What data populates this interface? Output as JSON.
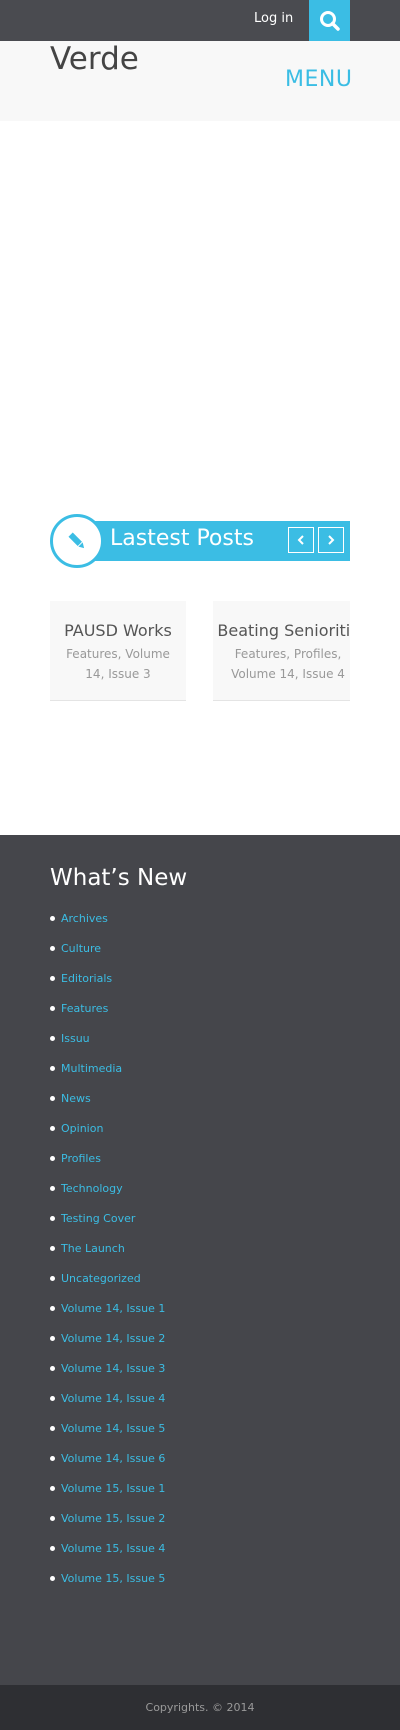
{
  "topbar": {
    "login_label": "Log in",
    "search_icon": "search-icon"
  },
  "header": {
    "site_title": "Verde",
    "menu_label": "MENU"
  },
  "latest": {
    "title": "Lastest Posts",
    "prev_icon": "chevron-left-icon",
    "next_icon": "chevron-right-icon",
    "badge_icon": "pencil-icon",
    "posts": [
      {
        "title": "PAUSD Works",
        "meta": "Features, Volume 14, Issue 3"
      },
      {
        "title": "Beating Senioritis",
        "meta": "Features, Profiles, Volume 14, Issue 4"
      }
    ]
  },
  "footer": {
    "title": "What’s New",
    "categories": [
      "Archives",
      "Culture",
      "Editorials",
      "Features",
      "Issuu",
      "Multimedia",
      "News",
      "Opinion",
      "Profiles",
      "Technology",
      "Testing Cover",
      "The Launch",
      "Uncategorized",
      "Volume 14, Issue 1",
      "Volume 14, Issue 2",
      "Volume 14, Issue 3",
      "Volume 14, Issue 4",
      "Volume 14, Issue 5",
      "Volume 14, Issue 6",
      "Volume 15, Issue 1",
      "Volume 15, Issue 2",
      "Volume 15, Issue 4",
      "Volume 15, Issue 5"
    ],
    "copyright": "Copyrights. © 2014"
  },
  "colors": {
    "accent": "#3bbde4",
    "topbar": "#4a4b50",
    "footer": "#45464b",
    "bottom_bar": "#2e2f33"
  }
}
